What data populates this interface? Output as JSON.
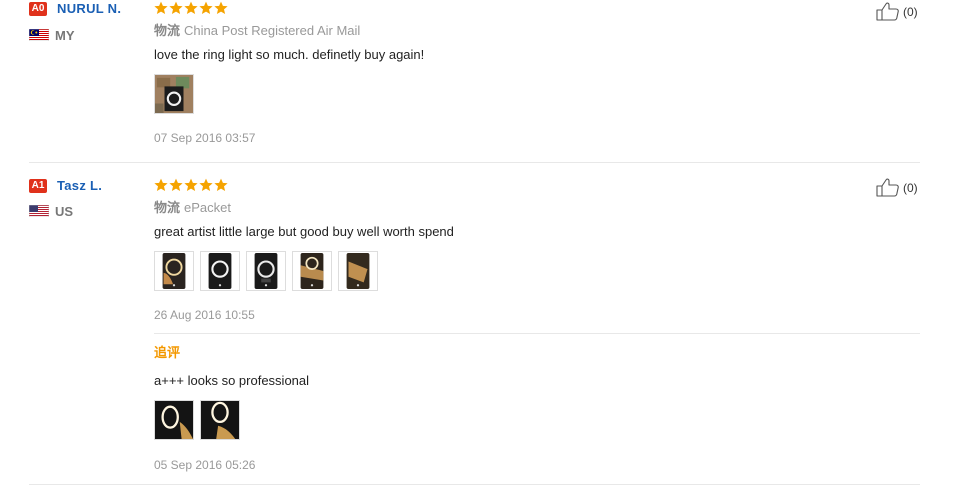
{
  "reviews": [
    {
      "badge": "A0",
      "user": "NURUL N.",
      "country": "MY",
      "rating": 5,
      "shipping_label": "物流",
      "shipping_method": "China Post Registered Air Mail",
      "text": "love the ring light so much. definetly buy again!",
      "date": "07 Sep 2016 03:57",
      "likes": "(0)"
    },
    {
      "badge": "A1",
      "user": "Tasz L.",
      "country": "US",
      "rating": 5,
      "shipping_label": "物流",
      "shipping_method": "ePacket",
      "text": "great artist little large but good buy well worth spend",
      "date": "26 Aug 2016 10:55",
      "likes": "(0)",
      "followup": {
        "label": "追评",
        "text": "a+++ looks so professional",
        "date": "05 Sep 2016 05:26"
      }
    }
  ]
}
